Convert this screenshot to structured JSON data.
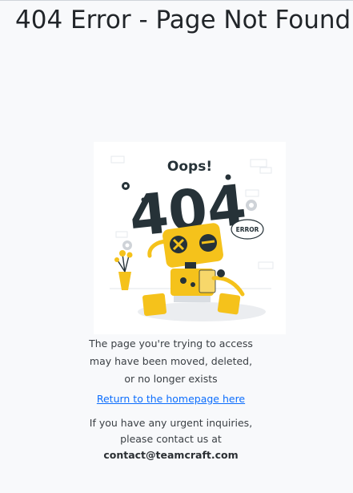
{
  "page": {
    "title": "404 Error - Page Not Found"
  },
  "illustration": {
    "oops_text": "Oops!",
    "code_text": "404",
    "bubble_text": "ERROR",
    "robot_color": "#f5c21b",
    "ink_color": "#263238"
  },
  "message": {
    "line1": "The page you're trying to access",
    "line2": "may have been moved, deleted,",
    "line3": "or no longer exists"
  },
  "home_link": {
    "label": "Return to the homepage here"
  },
  "inquiry": {
    "line1": "If you have any urgent inquiries,",
    "line2": "please contact us at",
    "email": "contact@teamcraft.com"
  },
  "colors": {
    "background": "#f8f9fb",
    "link": "#0d6efd",
    "text": "#212529"
  }
}
